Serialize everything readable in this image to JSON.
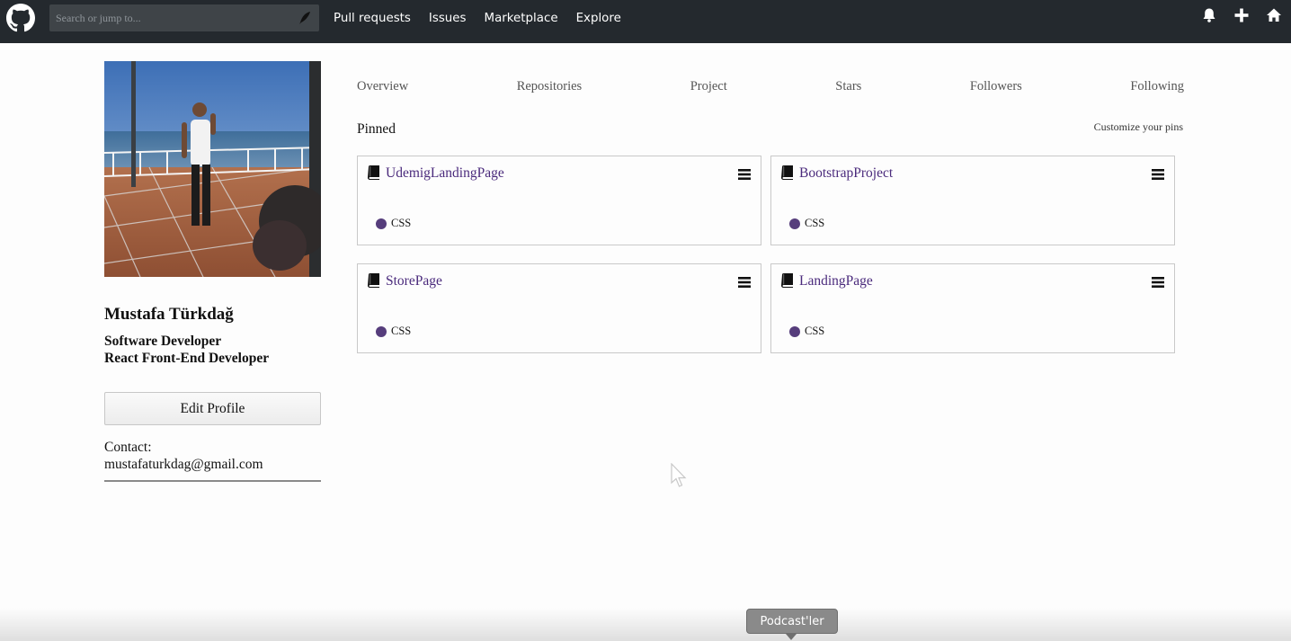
{
  "nav": {
    "search_placeholder": "Search or jump to...",
    "links": [
      "Pull requests",
      "Issues",
      "Marketplace",
      "Explore"
    ],
    "right_icons": [
      "bell-icon",
      "plus-icon",
      "home-icon"
    ]
  },
  "profile": {
    "name": "Mustafa Türkdağ",
    "bio_line1": "Software Developer",
    "bio_line2": "React Front-End Developer",
    "edit_label": "Edit Profile",
    "contact_label": "Contact:",
    "contact_email": "mustafaturkdag@gmail.com"
  },
  "tabs": [
    "Overview",
    "Repositories",
    "Project",
    "Stars",
    "Followers",
    "Following"
  ],
  "pinned": {
    "title": "Pinned",
    "customize_label": "Customize your pins",
    "repos": [
      {
        "name": "UdemigLandingPage",
        "language": "CSS"
      },
      {
        "name": "BootstrapProject",
        "language": "CSS"
      },
      {
        "name": "StorePage",
        "language": "CSS"
      },
      {
        "name": "LandingPage",
        "language": "CSS"
      }
    ],
    "language_color": "#563d7c",
    "link_color": "#4a2a7c"
  },
  "tooltip": {
    "label": "Podcast'ler"
  },
  "colors": {
    "nav_bg": "#24292e",
    "search_bg": "#3f4448"
  }
}
